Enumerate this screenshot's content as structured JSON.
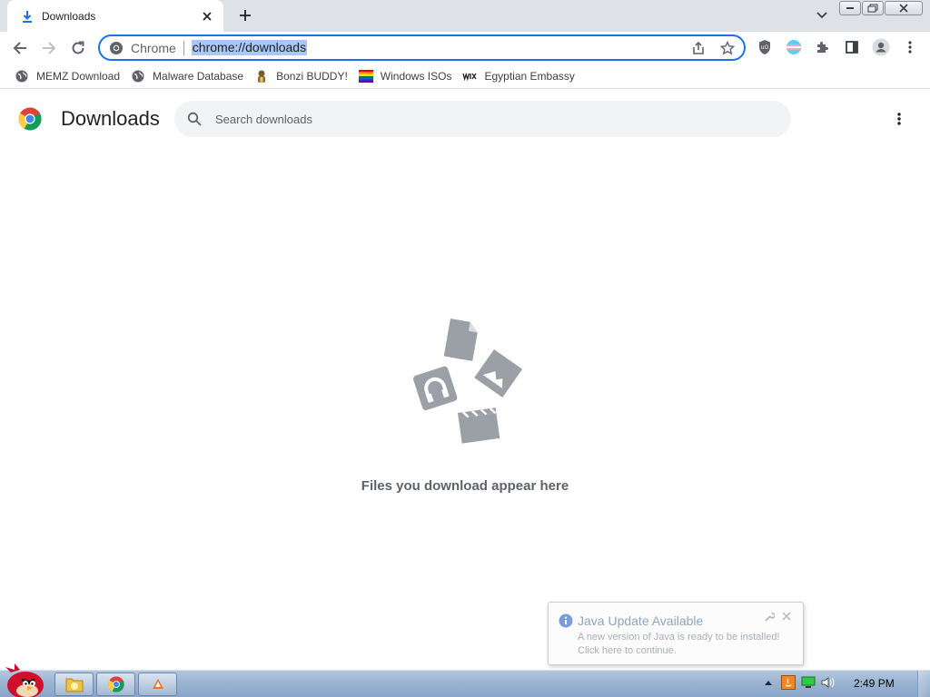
{
  "tab": {
    "title": "Downloads",
    "icon": "download-icon"
  },
  "toolbar": {
    "omnibox_chip": "Chrome",
    "url": "chrome://downloads"
  },
  "bookmarks": [
    {
      "label": "MEMZ Download",
      "icon": "globe-icon"
    },
    {
      "label": "Malware Database",
      "icon": "globe-icon"
    },
    {
      "label": "Bonzi BUDDY!",
      "icon": "bonzi-icon"
    },
    {
      "label": "Windows ISOs",
      "icon": "rainbow-flag-icon"
    },
    {
      "label": "Egyptian Embassy",
      "icon": "wix-icon"
    }
  ],
  "page": {
    "title": "Downloads",
    "search_placeholder": "Search downloads",
    "empty_message": "Files you download appear here"
  },
  "balloon": {
    "title": "Java Update Available",
    "body_line1": "A new version of Java is ready to be installed!",
    "body_line2": "Click here to continue."
  },
  "taskbar": {
    "clock": "2:49 PM"
  },
  "colors": {
    "accent": "#1a73e8",
    "tab_strip": "#dee1e6",
    "search_bg": "#f1f3f4",
    "illustration_gray": "#9aa0a6"
  }
}
